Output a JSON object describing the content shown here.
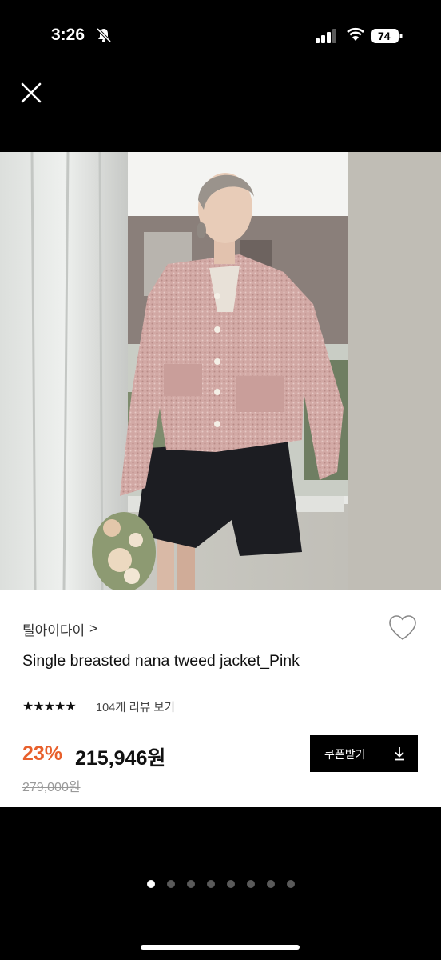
{
  "status": {
    "time": "3:26",
    "battery": "74"
  },
  "icons": {
    "close": "close-icon",
    "heart": "heart-icon",
    "download": "download-icon",
    "bell": "bell-slash-icon"
  },
  "product": {
    "brand": "틸아이다이",
    "brand_chevron": ">",
    "title": "Single breasted nana tweed jacket_Pink",
    "rating_stars": "★★★★★",
    "rating_value": 5,
    "reviews_link": "104개 리뷰 보기",
    "discount": "23%",
    "price": "215,946원",
    "original_price": "279,000원",
    "coupon_button": "쿠폰받기"
  },
  "pagination": {
    "total": 8,
    "current": 1
  },
  "colors": {
    "accent": "#e8602c",
    "background": "#000000",
    "panel": "#ffffff"
  }
}
